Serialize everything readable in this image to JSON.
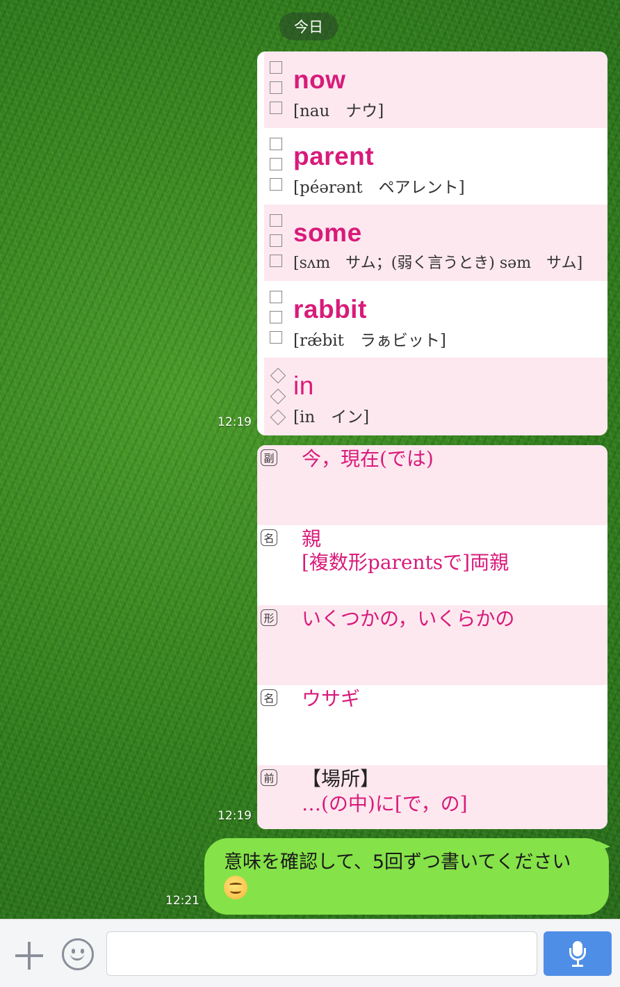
{
  "chat": {
    "date_label": "今日",
    "messages": [
      {
        "time": "12:19"
      },
      {
        "time": "12:19"
      },
      {
        "time": "12:21"
      }
    ]
  },
  "words": [
    {
      "word": "now",
      "pron": "[nau　ナウ]",
      "marker": "checkbox"
    },
    {
      "word": "parent",
      "pron": "[péərənt　ペアレント]",
      "marker": "checkbox"
    },
    {
      "word": "some",
      "pron": "[sʌm　サム；(弱く言うとき) səm　サム]",
      "marker": "checkbox"
    },
    {
      "word": "rabbit",
      "pron": "[rǽbit　ラぁビット]",
      "marker": "checkbox"
    },
    {
      "word": "in",
      "pron": "[in　イン]",
      "marker": "diamond"
    }
  ],
  "meanings": [
    {
      "pos": "副",
      "line1": "今，現在(では)",
      "line2": ""
    },
    {
      "pos": "名",
      "line1": "親",
      "line2": "[複数形parentsで]両親"
    },
    {
      "pos": "形",
      "line1": "いくつかの，いくらかの",
      "line2": ""
    },
    {
      "pos": "名",
      "line1": "ウサギ",
      "line2": ""
    },
    {
      "pos": "前",
      "line1": "【場所】",
      "line2": "…(の中)に[で，の]"
    }
  ],
  "reply": {
    "text": "意味を確認して、5回ずつ書いてください",
    "emoji": "smiling-face-emoji"
  },
  "input_bar": {
    "placeholder": "",
    "icons": [
      "plus-icon",
      "emoji-icon",
      "mic-icon"
    ]
  }
}
